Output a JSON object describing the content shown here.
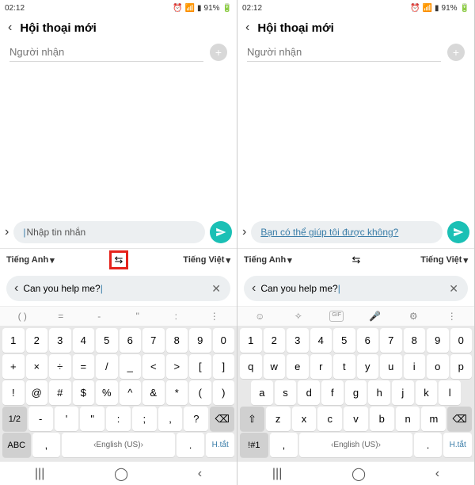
{
  "status": {
    "time": "02:12",
    "battery": "91%"
  },
  "header": {
    "title": "Hội thoại mới"
  },
  "recipient": {
    "placeholder": "Người nhận"
  },
  "message": {
    "placeholder": "Nhập tin nhắn",
    "translated": "Bạn có thể giúp tôi được không?"
  },
  "lang": {
    "source": "Tiếng Anh",
    "target": "Tiếng Việt",
    "swap_icon": "⇆"
  },
  "translate_input": {
    "text": "Can you help me?"
  },
  "toolbar_left": [
    "( )",
    "=",
    "-",
    "\"",
    ":"
  ],
  "toolbar_right_icons": [
    "emoji",
    "sticker",
    "gif",
    "mic",
    "settings"
  ],
  "keyboard_symbols": {
    "r1": [
      "1",
      "2",
      "3",
      "4",
      "5",
      "6",
      "7",
      "8",
      "9",
      "0"
    ],
    "r2": [
      "+",
      "×",
      "÷",
      "=",
      "/",
      "_",
      "<",
      ">",
      "[",
      "]"
    ],
    "r3": [
      "!",
      "@",
      "#",
      "$",
      "%",
      "^",
      "&",
      "*",
      "(",
      ")"
    ],
    "r4_fn": "1/2",
    "r4": [
      "-",
      "'",
      "\"",
      ":",
      ";",
      ",",
      "?"
    ],
    "r5_fn": "ABC",
    "r5_comma": ",",
    "r5_space": "English (US)",
    "r5_dot": ".",
    "r5_shortcut": "H.tắt"
  },
  "keyboard_alpha": {
    "r1": [
      "1",
      "2",
      "3",
      "4",
      "5",
      "6",
      "7",
      "8",
      "9",
      "0"
    ],
    "r2": [
      "q",
      "w",
      "e",
      "r",
      "t",
      "y",
      "u",
      "i",
      "o",
      "p"
    ],
    "r3": [
      "a",
      "s",
      "d",
      "f",
      "g",
      "h",
      "j",
      "k",
      "l"
    ],
    "r4": [
      "z",
      "x",
      "c",
      "v",
      "b",
      "n",
      "m"
    ],
    "r5_fn": "!#1",
    "r5_comma": ",",
    "r5_space": "English (US)",
    "r5_dot": ".",
    "r5_shortcut": "H.tắt"
  }
}
